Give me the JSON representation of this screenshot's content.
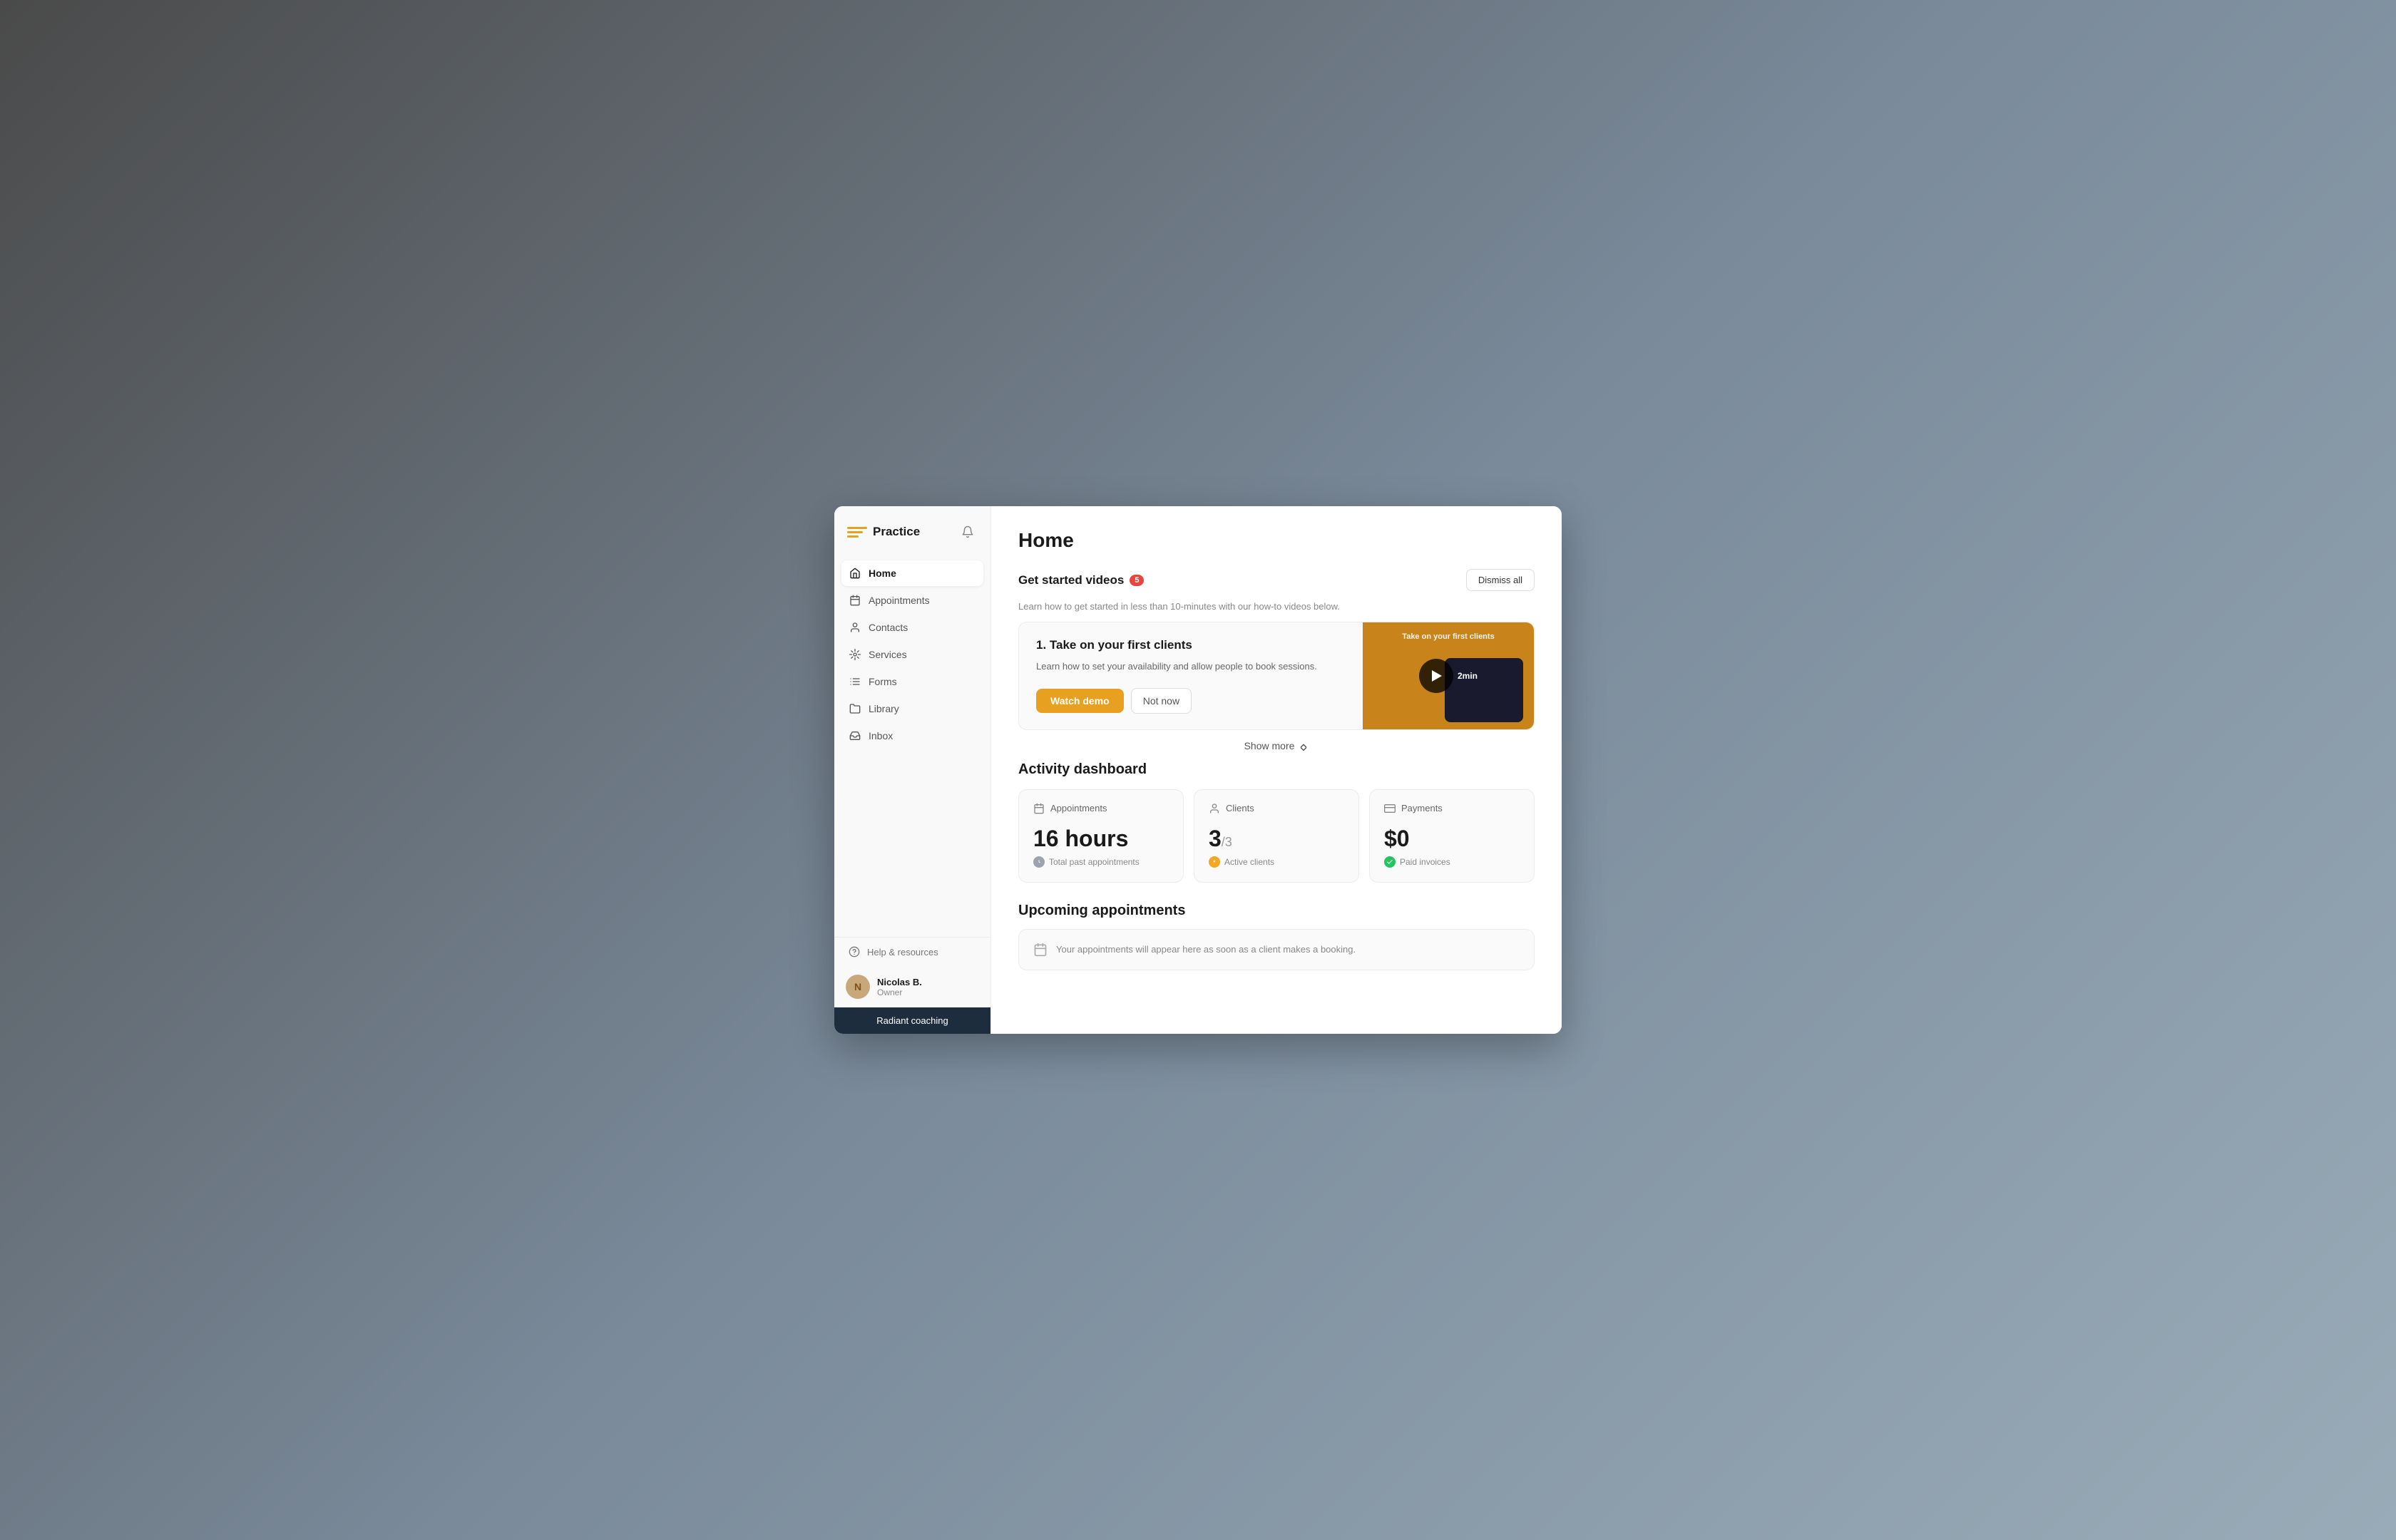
{
  "brand": {
    "name": "Practice",
    "icon_alt": "practice-logo"
  },
  "sidebar": {
    "nav_items": [
      {
        "id": "home",
        "label": "Home",
        "active": true
      },
      {
        "id": "appointments",
        "label": "Appointments",
        "active": false
      },
      {
        "id": "contacts",
        "label": "Contacts",
        "active": false
      },
      {
        "id": "services",
        "label": "Services",
        "active": false
      },
      {
        "id": "forms",
        "label": "Forms",
        "active": false
      },
      {
        "id": "library",
        "label": "Library",
        "active": false
      },
      {
        "id": "inbox",
        "label": "Inbox",
        "active": false
      }
    ],
    "footer": {
      "help_label": "Help & resources",
      "user_name": "Nicolas B.",
      "user_role": "Owner",
      "workspace": "Radiant coaching"
    }
  },
  "main": {
    "page_title": "Home",
    "get_started": {
      "title": "Get started videos",
      "badge_count": "5",
      "subtitle": "Learn how to get started in less than 10-minutes with our how-to videos below.",
      "dismiss_label": "Dismiss all",
      "video_card": {
        "number_title": "1. Take on your first clients",
        "description": "Learn how to set your availability and allow people to book sessions.",
        "watch_label": "Watch demo",
        "not_now_label": "Not now",
        "duration": "2min",
        "thumb_label": "Take on your first clients"
      },
      "show_more_label": "Show more"
    },
    "activity_dashboard": {
      "title": "Activity dashboard",
      "cards": [
        {
          "id": "appointments",
          "label": "Appointments",
          "value": "16 hours",
          "sub_text": "Total past appointments",
          "status": "gray"
        },
        {
          "id": "clients",
          "label": "Clients",
          "value": "3",
          "sub_value": "/3",
          "sub_text": "Active clients",
          "status": "yellow"
        },
        {
          "id": "payments",
          "label": "Payments",
          "value": "$0",
          "sub_text": "Paid invoices",
          "status": "green"
        }
      ]
    },
    "upcoming_appointments": {
      "title": "Upcoming appointments",
      "empty_text": "Your appointments will appear here as soon as a client makes a booking."
    }
  }
}
